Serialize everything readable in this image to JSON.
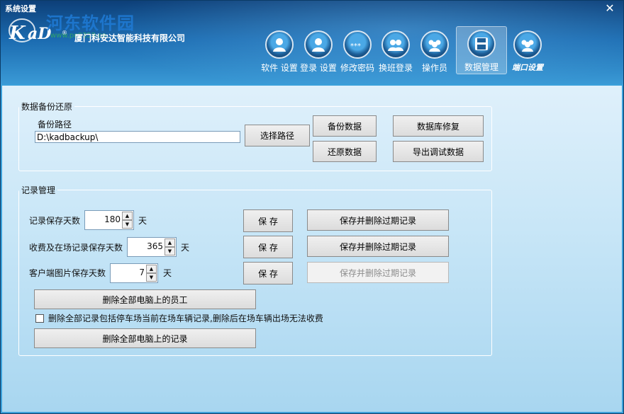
{
  "window": {
    "title": "系统设置",
    "close_icon": "close-icon"
  },
  "brand": {
    "watermark": "河东软件园",
    "watermark_url": "www.pc0359.cn",
    "logo_text": "KaD",
    "company": "厦门科安达智能科技有限公司"
  },
  "nav": [
    {
      "label": "软件 设置",
      "icon": "user-icon"
    },
    {
      "label": "登录 设置",
      "icon": "user-login-icon"
    },
    {
      "label": "修改密码",
      "icon": "password-icon"
    },
    {
      "label": "换班登录",
      "icon": "shift-users-icon"
    },
    {
      "label": "操作员",
      "icon": "operators-icon"
    },
    {
      "label": "数据管理",
      "icon": "floppy-disk-icon",
      "active": true
    },
    {
      "label": "端口设置",
      "icon": "port-users-icon"
    }
  ],
  "backup": {
    "legend": "数据备份还原",
    "path_label": "备份路径",
    "path_value": "D:\\kadbackup\\",
    "choose_path": "选择路径",
    "backup_data": "备份数据",
    "restore_data": "还原数据",
    "db_repair": "数据库修复",
    "export_debug": "导出调试数据"
  },
  "records": {
    "legend": "记录管理",
    "rows": [
      {
        "label": "记录保存天数",
        "value": "180",
        "unit": "天",
        "save": "保 存",
        "save_delete": "保存并删除过期记录",
        "save_delete_enabled": true
      },
      {
        "label": "收费及在场记录保存天数",
        "value": "365",
        "unit": "天",
        "save": "保 存",
        "save_delete": "保存并删除过期记录",
        "save_delete_enabled": true
      },
      {
        "label": "客户端图片保存天数",
        "value": "7",
        "unit": "天",
        "save": "保 存",
        "save_delete": "保存并删除过期记录",
        "save_delete_enabled": false
      }
    ],
    "delete_staff": "删除全部电脑上的员工",
    "include_parked_label": "删除全部记录包括停车场当前在场车辆记录,删除后在场车辆出场无法收费",
    "include_parked_checked": false,
    "delete_records": "删除全部电脑上的记录"
  }
}
